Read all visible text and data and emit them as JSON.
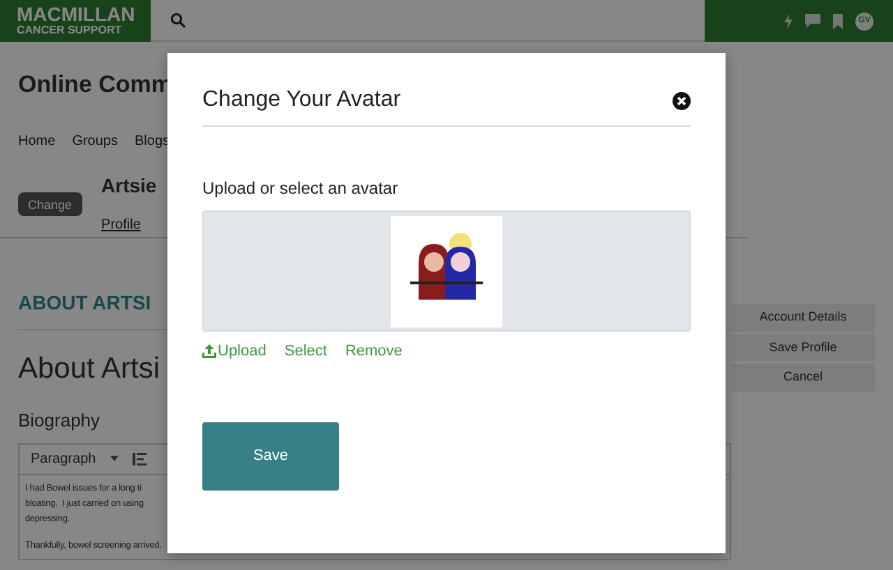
{
  "header": {
    "logo_lines": [
      "MACMILLAN",
      "CANCER SUPPORT"
    ],
    "user_initials": "GV"
  },
  "page": {
    "title": "Online Comm",
    "nav": [
      "Home",
      "Groups",
      "Blogs"
    ],
    "profile": {
      "name": "Artsie",
      "change_label": "Change",
      "tabs": [
        "Profile"
      ]
    },
    "section_banner": "ABOUT ARTSI",
    "heading": "About Artsi",
    "biography_label": "Biography",
    "editor": {
      "format": "Paragraph",
      "paragraphs": [
        [
          "I had Bowel issues for a long ti",
          "bloating.  I just carried on using",
          "depressing."
        ],
        [
          "Thankfully, bowel screening arrived."
        ]
      ]
    },
    "side_buttons": [
      "Account Details",
      "Save Profile",
      "Cancel"
    ]
  },
  "modal": {
    "title": "Change Your Avatar",
    "prompt": "Upload or select an avatar",
    "actions": [
      {
        "label": "Upload",
        "kind": "upload"
      },
      {
        "label": "Select",
        "kind": "plain"
      },
      {
        "label": "Remove",
        "kind": "plain"
      }
    ],
    "save": "Save"
  }
}
